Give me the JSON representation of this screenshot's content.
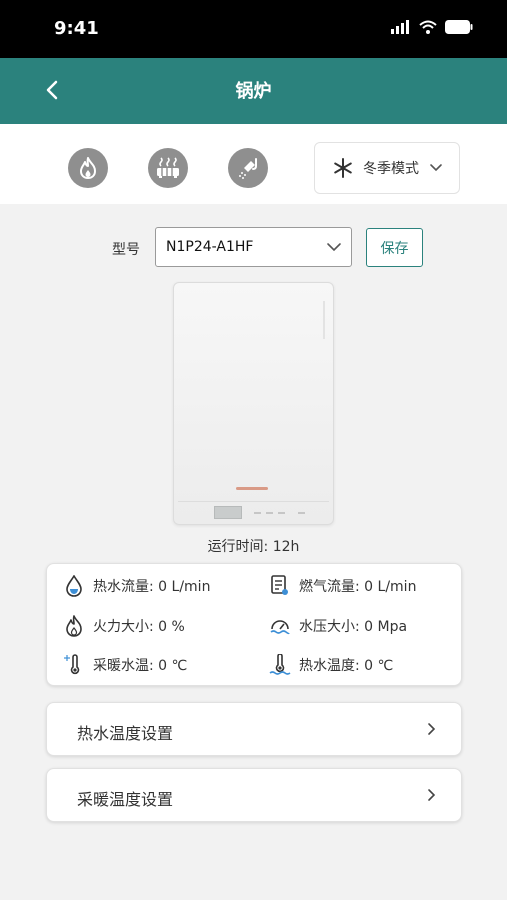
{
  "status_bar": {
    "time": "9:41"
  },
  "nav": {
    "title": "锅炉"
  },
  "modes": {
    "icons": [
      "flame-icon",
      "radiator-icon",
      "shower-icon"
    ],
    "season": {
      "label": "冬季模式",
      "icon": "snowflake-icon"
    }
  },
  "model": {
    "label": "型号",
    "value": "N1P24-A1HF",
    "save_label": "保存"
  },
  "runtime": "运行时间: 12h",
  "stats": {
    "hot_water_flow": "热水流量: 0 L/min",
    "gas_flow": "燃气流量: 0 L/min",
    "fire_power": "火力大小: 0 %",
    "water_pressure": "水压大小: 0 Mpa",
    "heating_water_temp": "采暖水温: 0 ℃",
    "hot_water_temp": "热水温度: 0 ℃"
  },
  "settings": {
    "hot_water_temp_setting": "热水温度设置",
    "heating_temp_setting": "采暖温度设置"
  },
  "colors": {
    "accent": "#2b827d",
    "icon_gray": "#8f8f8f",
    "water_blue": "#3d8fd6"
  }
}
